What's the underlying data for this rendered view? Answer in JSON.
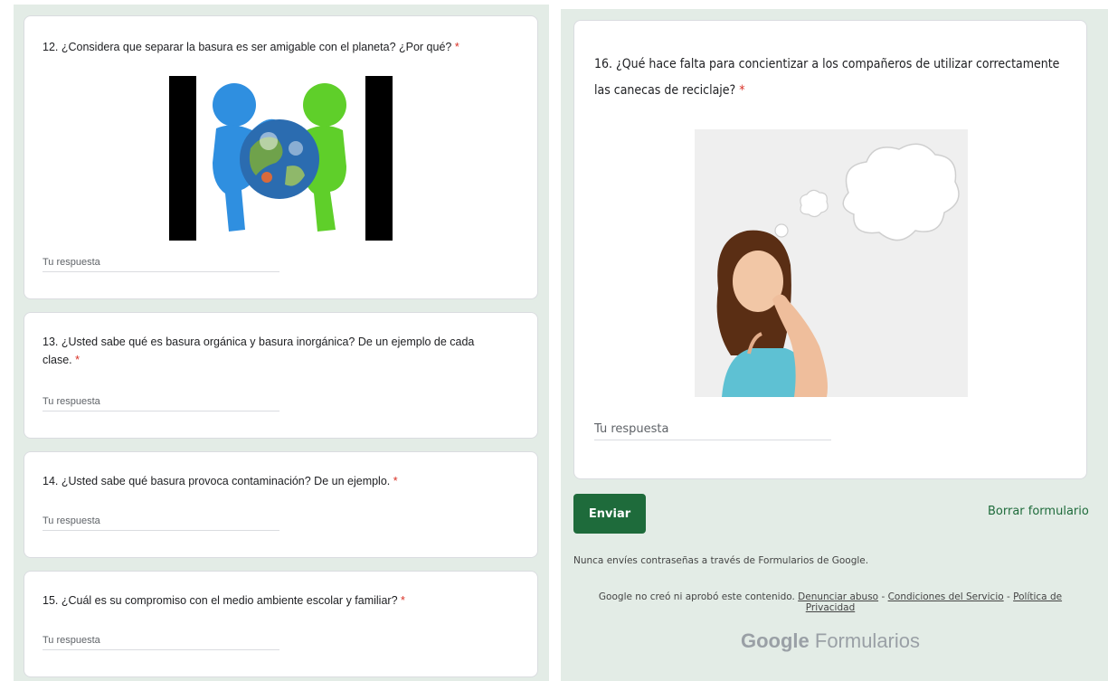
{
  "colors": {
    "accent": "#1e6b3b",
    "required": "#d93025",
    "panel_bg": "#e3ece6"
  },
  "questions": [
    {
      "text": "12. ¿Considera que separar la basura es ser amigable con el planeta? ¿Por qué?",
      "required_mark": "*",
      "answer_placeholder": "Tu respuesta"
    },
    {
      "text": "13. ¿Usted sabe qué es basura orgánica y basura inorgánica? De un ejemplo de cada clase.",
      "required_mark": "*",
      "answer_placeholder": "Tu respuesta"
    },
    {
      "text": "14. ¿Usted sabe qué basura provoca contaminación? De un ejemplo.",
      "required_mark": "*",
      "answer_placeholder": "Tu respuesta"
    },
    {
      "text": "15. ¿Cuál es su compromiso con el medio ambiente escolar y familiar?",
      "required_mark": "*",
      "answer_placeholder": "Tu respuesta"
    },
    {
      "text": "16. ¿Qué hace falta para concientizar a los compañeros de utilizar correctamente las canecas de reciclaje?",
      "required_mark": "*",
      "answer_placeholder": "Tu respuesta"
    }
  ],
  "actions": {
    "submit_label": "Enviar",
    "clear_label": "Borrar formulario"
  },
  "footer": {
    "notice": "Nunca envíes contraseñas a través de Formularios de Google.",
    "disclaimer": "Google no creó ni aprobó este contenido.",
    "sep1": " - ",
    "sep2": " - ",
    "link_abuse": "Denunciar abuso",
    "link_terms": "Condiciones del Servicio",
    "link_privacy": "Política de Privacidad",
    "brand_google": "Google",
    "brand_forms": "Formularios"
  }
}
